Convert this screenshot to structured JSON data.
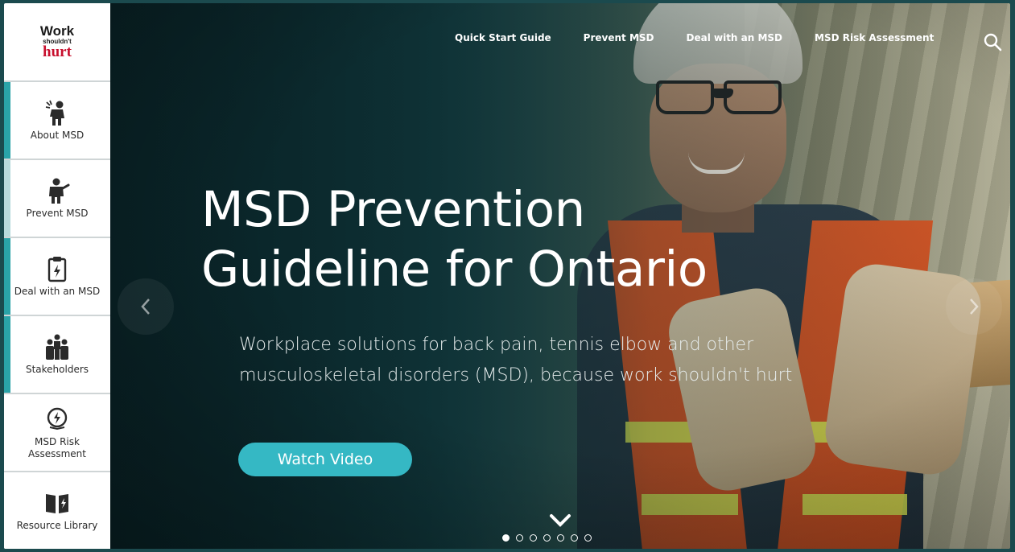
{
  "logo": {
    "line1": "Work",
    "line2": "shouldn't",
    "line3": "hurt"
  },
  "sidebar": {
    "items": [
      {
        "label": "About MSD",
        "icon": "person-pain-icon",
        "accent": "#2aa3a8"
      },
      {
        "label": "Prevent MSD",
        "icon": "person-stop-icon",
        "accent": "#b7dadc"
      },
      {
        "label": "Deal with an MSD",
        "icon": "clipboard-icon",
        "accent": "#2aa3a8"
      },
      {
        "label": "Stakeholders",
        "icon": "people-group-icon",
        "accent": "#2aa3a8"
      },
      {
        "label": "MSD Risk Assessment",
        "icon": "risk-gauge-icon",
        "accent": "#ffffff"
      },
      {
        "label": "Resource Library",
        "icon": "book-icon",
        "accent": "#ffffff"
      }
    ]
  },
  "topnav": {
    "items": [
      "Quick Start Guide",
      "Prevent MSD",
      "Deal with an MSD",
      "MSD Risk Assessment"
    ]
  },
  "hero": {
    "headline_line1": "MSD Prevention",
    "headline_line2": "Guideline for Ontario",
    "subtext": "Workplace solutions for back pain, tennis elbow and other musculoskeletal disorders (MSD), because work shouldn't hurt",
    "button_label": "Watch Video",
    "button_color": "#35b8c4"
  },
  "carousel": {
    "slides": 7,
    "active": 1
  }
}
